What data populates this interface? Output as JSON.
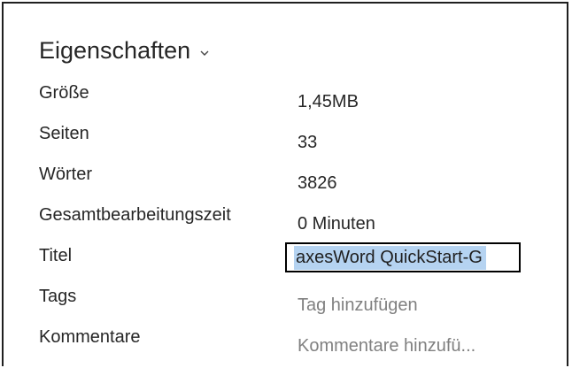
{
  "panel": {
    "heading": "Eigenschaften",
    "heading_icon": "chevron-down-icon"
  },
  "properties": [
    {
      "label": "Größe",
      "value": "1,45MB"
    },
    {
      "label": "Seiten",
      "value": "33"
    },
    {
      "label": "Wörter",
      "value": "3826"
    },
    {
      "label": "Gesamtbearbeitungszeit",
      "value": "0 Minuten"
    },
    {
      "label": "Titel",
      "value": "axesWord QuickStart-G"
    },
    {
      "label": "Tags",
      "placeholder": "Tag hinzufügen"
    },
    {
      "label": "Kommentare",
      "placeholder": "Kommentare hinzufü..."
    }
  ],
  "colors": {
    "text": "#262626",
    "placeholder": "#808080",
    "selection": "#b5d3f1",
    "border": "#1f1f1f"
  }
}
